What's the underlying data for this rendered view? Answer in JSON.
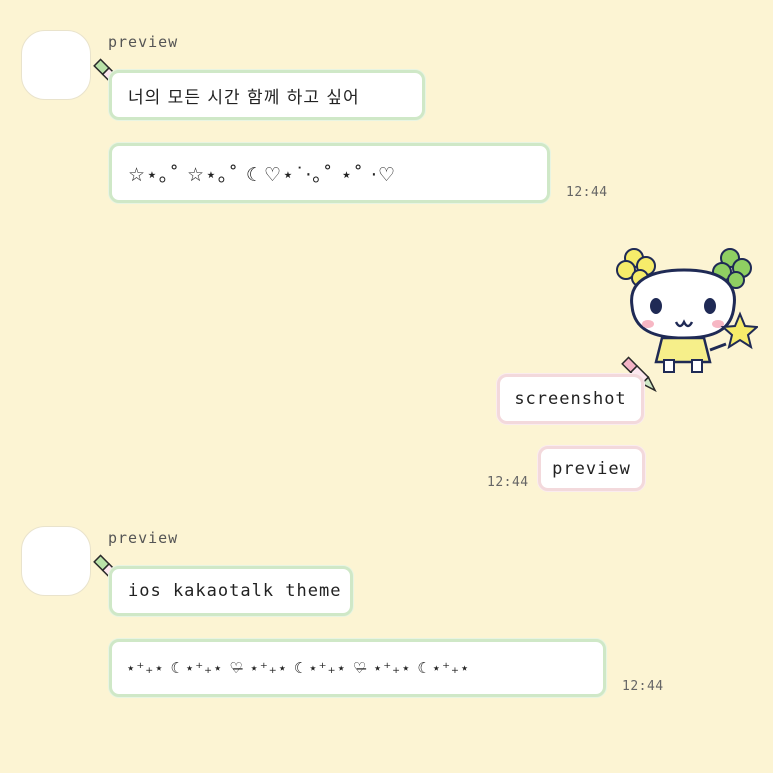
{
  "theme": {
    "background": "#fcf4d3",
    "in_border": "#cfe8c7",
    "out_border": "#f3d9dc"
  },
  "group1": {
    "sender": "preview",
    "msg1": "너의 모든 시간 함께 하고 싶어",
    "msg2": "☆⋆｡˚  ☆⋆｡˚  ☾♡⋆˙⋅｡˚ ⋆˚  ⋅♡",
    "time": "12:44"
  },
  "sticker": {
    "icon": "tamagotchi-character-sticker"
  },
  "outgoing": {
    "msg1": "screenshot",
    "msg2": "preview",
    "time": "12:44"
  },
  "group2": {
    "sender": "preview",
    "msg1": "ios kakaotalk theme",
    "msg2": "⋆⁺₊⋆ ☾⋆⁺₊⋆ ♡̶ ⋆⁺₊⋆ ☾⋆⁺₊⋆ ♡̶ ⋆⁺₊⋆ ☾⋆⁺₊⋆",
    "time": "12:44"
  }
}
